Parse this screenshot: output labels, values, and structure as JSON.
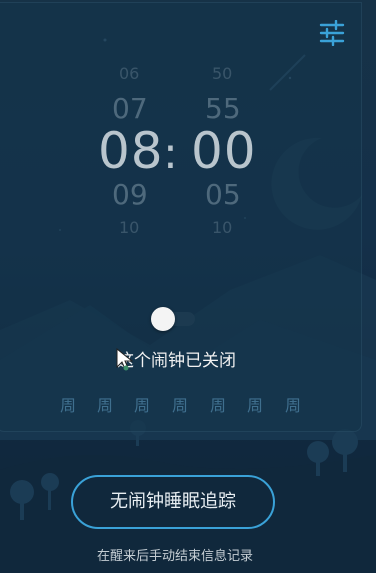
{
  "alarm_picker": {
    "hour_far_above": "06",
    "hour_above": "07",
    "hour_selected": "08",
    "hour_below": "09",
    "hour_far_below": "10",
    "separator": ":",
    "minute_far_above": "50",
    "minute_above": "55",
    "minute_selected": "00",
    "minute_below": "05",
    "minute_far_below": "10"
  },
  "alarm_toggle": {
    "state": "off"
  },
  "status_text": "这个闹钟已关闭",
  "weekdays": [
    "周",
    "周",
    "周",
    "周",
    "周",
    "周",
    "周"
  ],
  "sleep_track_button": "无闹钟睡眠追踪",
  "hint_text": "在醒来后手动结束信息记录",
  "icons": {
    "settings": "sliders-icon",
    "cursor": "mouse-pointer-icon"
  },
  "colors": {
    "accent": "#3aa2d8",
    "background": "#14304a"
  }
}
